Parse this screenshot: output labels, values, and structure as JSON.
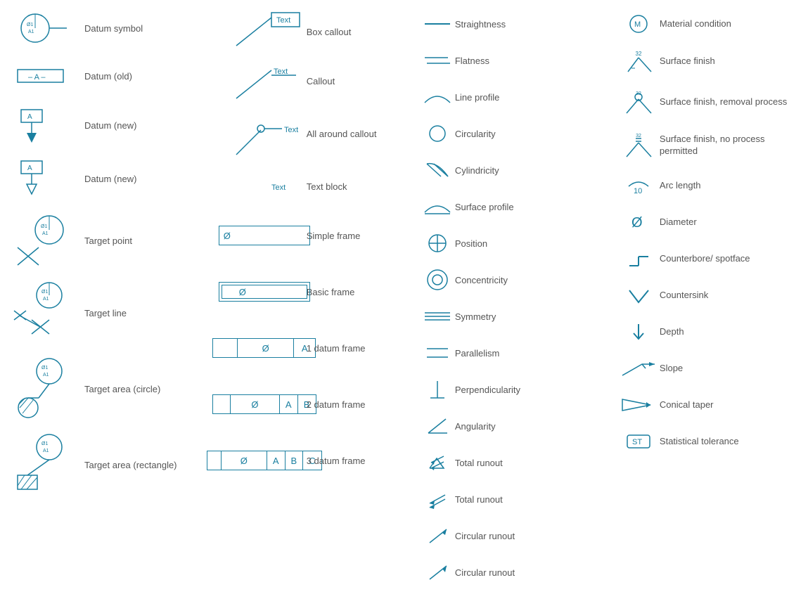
{
  "col1": {
    "items": [
      {
        "id": "datum-symbol",
        "label": "Datum symbol"
      },
      {
        "id": "datum-old",
        "label": "Datum (old)"
      },
      {
        "id": "datum-new-1",
        "label": "Datum (new)"
      },
      {
        "id": "datum-new-2",
        "label": "Datum (new)"
      },
      {
        "id": "target-point",
        "label": "Target point"
      },
      {
        "id": "target-line",
        "label": "Target line"
      },
      {
        "id": "target-area-circle",
        "label": "Target area (circle)"
      },
      {
        "id": "target-area-rect",
        "label": "Target area (rectangle)"
      }
    ]
  },
  "col2": {
    "items": [
      {
        "id": "box-callout",
        "label": "Box callout"
      },
      {
        "id": "callout",
        "label": "Callout"
      },
      {
        "id": "all-around-callout",
        "label": "All around callout"
      },
      {
        "id": "text-block",
        "label": "Text block"
      },
      {
        "id": "simple-frame",
        "label": "Simple frame"
      },
      {
        "id": "basic-frame",
        "label": "Basic frame"
      },
      {
        "id": "datum-frame-1",
        "label": "1 datum frame"
      },
      {
        "id": "datum-frame-2",
        "label": "2 datum frame"
      },
      {
        "id": "datum-frame-3",
        "label": "3 datum frame"
      }
    ]
  },
  "col3": {
    "items": [
      {
        "id": "straightness",
        "label": "Straightness"
      },
      {
        "id": "flatness",
        "label": "Flatness"
      },
      {
        "id": "line-profile",
        "label": "Line profile"
      },
      {
        "id": "circularity",
        "label": "Circularity"
      },
      {
        "id": "cylindricity",
        "label": "Cylindricity"
      },
      {
        "id": "surface-profile",
        "label": "Surface profile"
      },
      {
        "id": "position",
        "label": "Position"
      },
      {
        "id": "concentricity",
        "label": "Concentricity"
      },
      {
        "id": "symmetry",
        "label": "Symmetry"
      },
      {
        "id": "parallelism",
        "label": "Parallelism"
      },
      {
        "id": "perpendicularity",
        "label": "Perpendicularity"
      },
      {
        "id": "angularity",
        "label": "Angularity"
      },
      {
        "id": "total-runout-1",
        "label": "Total runout"
      },
      {
        "id": "total-runout-2",
        "label": "Total runout"
      },
      {
        "id": "circular-runout-1",
        "label": "Circular runout"
      },
      {
        "id": "circular-runout-2",
        "label": "Circular runout"
      }
    ]
  },
  "col4": {
    "items": [
      {
        "id": "material-condition",
        "label": "Material condition"
      },
      {
        "id": "surface-finish-1",
        "label": "Surface finish"
      },
      {
        "id": "surface-finish-2",
        "label": "Surface finish, removal process"
      },
      {
        "id": "surface-finish-3",
        "label": "Surface finish, no process permitted"
      },
      {
        "id": "arc-length",
        "label": "Arc length"
      },
      {
        "id": "diameter",
        "label": "Diameter"
      },
      {
        "id": "counterbore",
        "label": "Counterbore/ spotface"
      },
      {
        "id": "countersink",
        "label": "Countersink"
      },
      {
        "id": "depth",
        "label": "Depth"
      },
      {
        "id": "slope",
        "label": "Slope"
      },
      {
        "id": "conical-taper",
        "label": "Conical taper"
      },
      {
        "id": "statistical-tolerance",
        "label": "Statistical tolerance"
      }
    ]
  },
  "colors": {
    "cyan": "#1a7fa0",
    "text": "#555555"
  }
}
